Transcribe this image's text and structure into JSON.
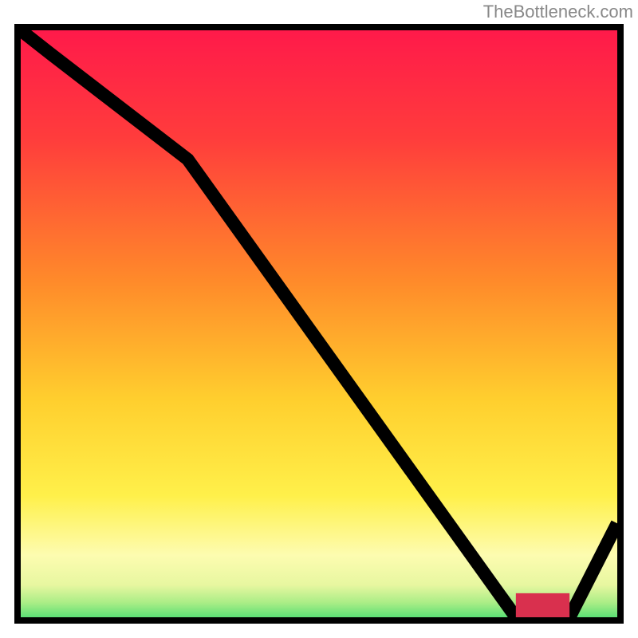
{
  "watermark": "TheBottleneck.com",
  "chart_data": {
    "type": "line",
    "title": "",
    "xlabel": "",
    "ylabel": "",
    "xlim": [
      0,
      100
    ],
    "ylim": [
      0,
      100
    ],
    "x": [
      0,
      5,
      28,
      83,
      92,
      100
    ],
    "values": [
      101,
      96,
      78,
      0,
      0,
      16
    ],
    "optimum_range": {
      "x0": 83,
      "x1": 92,
      "y": 0
    },
    "gradient_stops": [
      {
        "offset": 0,
        "color": "#ff1a4a"
      },
      {
        "offset": 18,
        "color": "#ff3c3c"
      },
      {
        "offset": 42,
        "color": "#ff8a2a"
      },
      {
        "offset": 62,
        "color": "#ffcf2e"
      },
      {
        "offset": 78,
        "color": "#fff04a"
      },
      {
        "offset": 88,
        "color": "#fdfcb0"
      },
      {
        "offset": 93,
        "color": "#e7f7a0"
      },
      {
        "offset": 96,
        "color": "#a9ed86"
      },
      {
        "offset": 100,
        "color": "#28d66a"
      }
    ]
  }
}
